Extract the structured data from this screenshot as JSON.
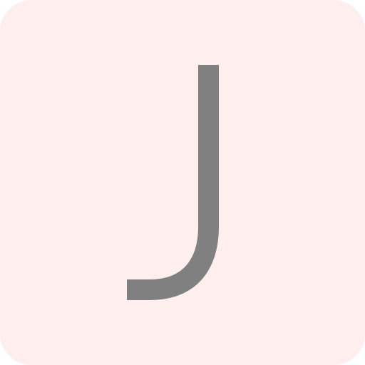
{
  "tile": {
    "letter": "J",
    "background_color": "#FFEEEE",
    "letter_color": "#808080"
  }
}
